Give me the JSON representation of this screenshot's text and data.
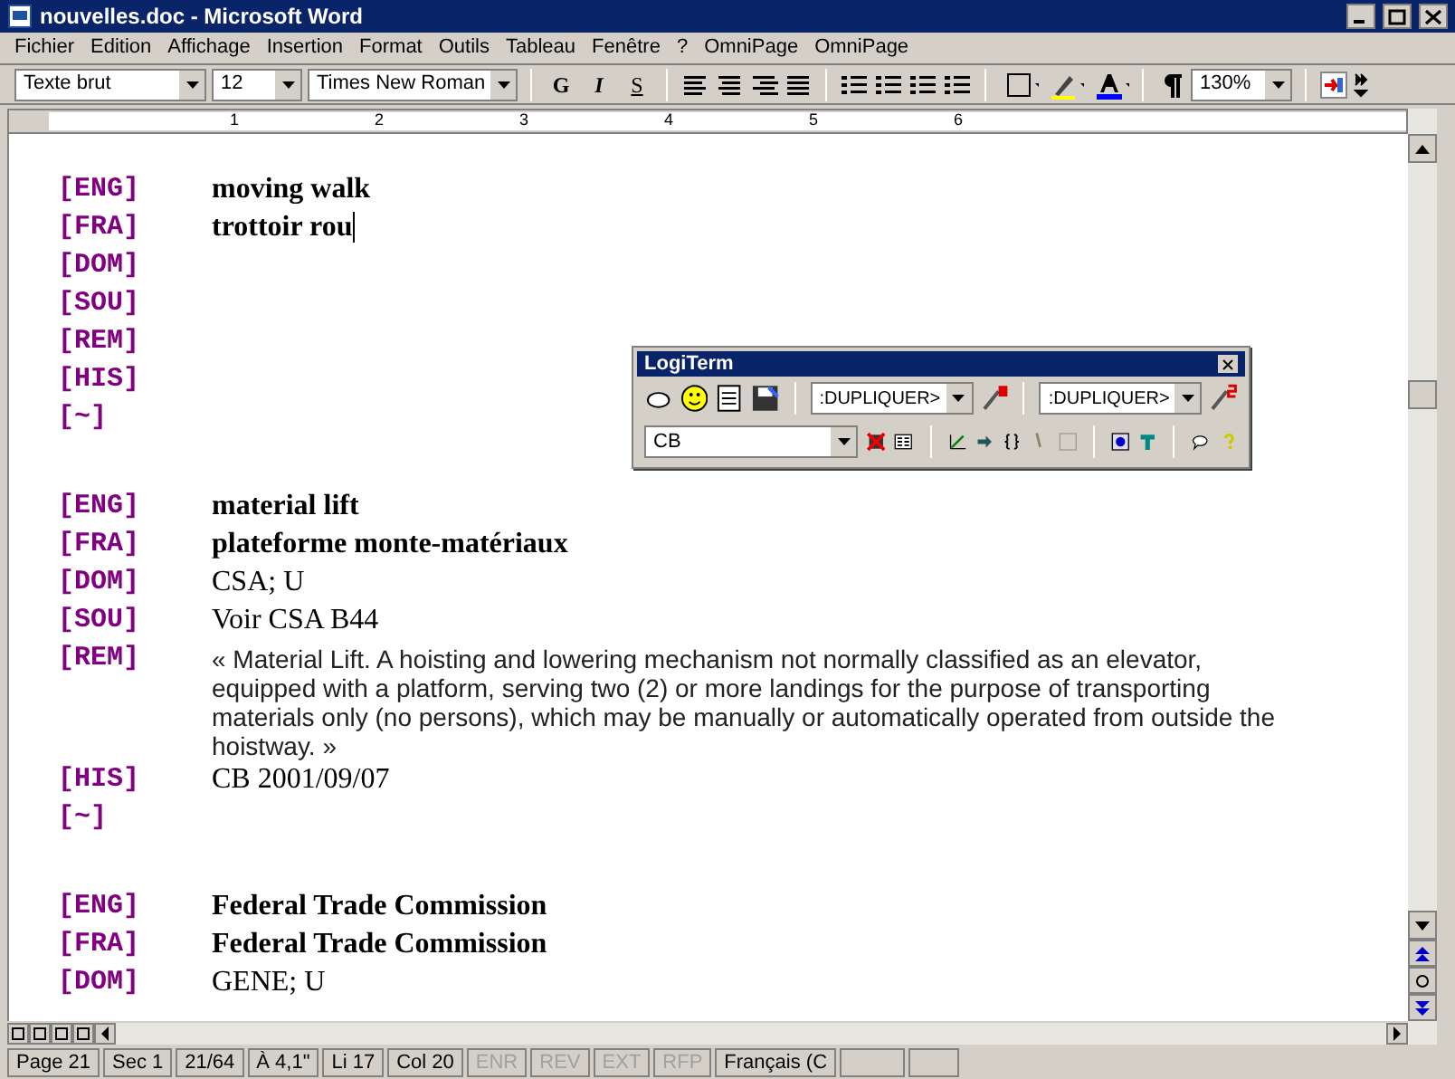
{
  "window": {
    "title": "nouvelles.doc - Microsoft Word"
  },
  "menu": [
    "Fichier",
    "Edition",
    "Affichage",
    "Insertion",
    "Format",
    "Outils",
    "Tableau",
    "Fenêtre",
    "?",
    "OmniPage",
    "OmniPage"
  ],
  "toolbar": {
    "style": "Texte brut",
    "size": "12",
    "font": "Times New Roman",
    "format_buttons": [
      "G",
      "I",
      "S"
    ],
    "zoom": "130%"
  },
  "ruler": [
    "1",
    "2",
    "3",
    "4",
    "5",
    "6"
  ],
  "records": [
    {
      "fields": [
        {
          "tag": "[ENG]",
          "text": "moving walk",
          "kind": "term"
        },
        {
          "tag": "[FRA]",
          "text": "trottoir rou",
          "kind": "term",
          "cursor": true
        },
        {
          "tag": "[DOM]"
        },
        {
          "tag": "[SOU]"
        },
        {
          "tag": "[REM]"
        },
        {
          "tag": "[HIS]"
        },
        {
          "tag": "[~]"
        }
      ]
    },
    {
      "fields": [
        {
          "tag": "[ENG]",
          "text": "material lift",
          "kind": "term"
        },
        {
          "tag": "[FRA]",
          "text": "plateforme monte-matériaux",
          "kind": "term"
        },
        {
          "tag": "[DOM]",
          "text": "CSA; U",
          "kind": "plain"
        },
        {
          "tag": "[SOU]",
          "text": "Voir CSA B44",
          "kind": "plain"
        },
        {
          "tag": "[REM]",
          "text": "« Material Lift. A hoisting and lowering mechanism not normally classified as an elevator, equipped with a platform, serving two (2) or more landings for the purpose of transporting materials only (no persons), which may be manually or automatically operated from outside the hoistway. »",
          "kind": "note"
        },
        {
          "tag": "[HIS]",
          "text": "CB 2001/09/07",
          "kind": "plain"
        },
        {
          "tag": "[~]"
        }
      ]
    },
    {
      "fields": [
        {
          "tag": "[ENG]",
          "text": "Federal Trade Commission",
          "kind": "term"
        },
        {
          "tag": "[FRA]",
          "text": "Federal Trade Commission",
          "kind": "term"
        },
        {
          "tag": "[DOM]",
          "text": "GENE; U",
          "kind": "plain"
        }
      ]
    }
  ],
  "logiterm": {
    "title": "LogiTerm",
    "dropdown_1": ":DUPLIQUER>",
    "dropdown_2": ":DUPLIQUER>",
    "field": "CB"
  },
  "status_bar": [
    {
      "text": "Page 21",
      "disabled": false
    },
    {
      "text": "Sec 1",
      "disabled": false
    },
    {
      "text": "21/64",
      "disabled": false
    },
    {
      "text": "À 4,1\"",
      "disabled": false
    },
    {
      "text": "Li 17",
      "disabled": false
    },
    {
      "text": "Col 20",
      "disabled": false
    },
    {
      "text": "ENR",
      "disabled": true
    },
    {
      "text": "REV",
      "disabled": true
    },
    {
      "text": "EXT",
      "disabled": true
    },
    {
      "text": "RFP",
      "disabled": true
    },
    {
      "text": "Français (C",
      "disabled": false
    }
  ]
}
